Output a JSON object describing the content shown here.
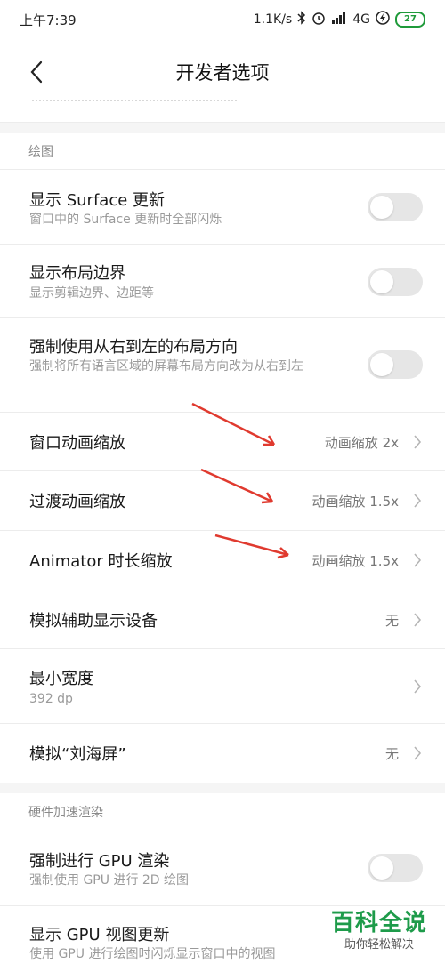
{
  "status": {
    "time": "上午7:39",
    "net_speed": "1.1K/s",
    "network": "4G",
    "battery": "27",
    "icons": [
      "bluetooth-icon",
      "alarm-icon",
      "signal-icon",
      "charging-icon",
      "battery-icon"
    ]
  },
  "header": {
    "title": "开发者选项",
    "back_icon": "chevron-left-icon"
  },
  "sections": {
    "drawing": "绘图",
    "hw_render": "硬件加速渲染"
  },
  "rows": {
    "surface": {
      "title": "显示 Surface 更新",
      "sub": "窗口中的 Surface 更新时全部闪烁",
      "on": false
    },
    "layout_bounds": {
      "title": "显示布局边界",
      "sub": "显示剪辑边界、边距等",
      "on": false
    },
    "rtl": {
      "title": "强制使用从右到左的布局方向",
      "sub": "强制将所有语言区域的屏幕布局方向改为从右到左",
      "on": false
    },
    "window_anim": {
      "title": "窗口动画缩放",
      "value": "动画缩放 2x"
    },
    "transition_anim": {
      "title": "过渡动画缩放",
      "value": "动画缩放 1.5x"
    },
    "animator": {
      "title": "Animator 时长缩放",
      "value": "动画缩放 1.5x"
    },
    "secondary_display": {
      "title": "模拟辅助显示设备",
      "value": "无"
    },
    "min_width": {
      "title": "最小宽度",
      "sub": "392 dp"
    },
    "notch": {
      "title": "模拟“刘海屏”",
      "value": "无"
    },
    "force_gpu": {
      "title": "强制进行 GPU 渲染",
      "sub": "强制使用 GPU 进行 2D 绘图",
      "on": false
    },
    "gpu_view": {
      "title": "显示 GPU 视图更新",
      "sub": "使用 GPU 进行绘图时闪烁显示窗口中的视图"
    }
  },
  "watermark": {
    "main": "百科全说",
    "sub": "助你轻松解决"
  },
  "colors": {
    "annotation_arrow": "#e03a2f",
    "watermark": "#1e9b4a",
    "toggle_off": "#e6e6e6"
  }
}
